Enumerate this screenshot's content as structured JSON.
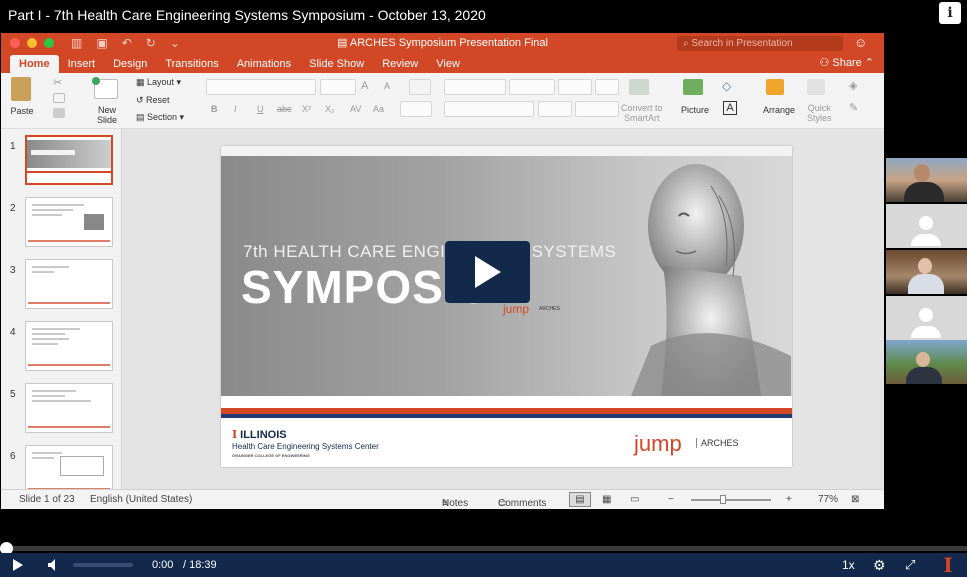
{
  "video": {
    "title": "Part I - 7th Health Care Engineering Systems Symposium - October 13, 2020",
    "info_icon_glyph": "i"
  },
  "ppt": {
    "doc_title": "ARCHES Symposium Presentation Final",
    "search_placeholder": "Search in Presentation",
    "share_label": "Share",
    "tabs": [
      "Home",
      "Insert",
      "Design",
      "Transitions",
      "Animations",
      "Slide Show",
      "Review",
      "View"
    ],
    "ribbon": {
      "paste": "Paste",
      "new_slide_line1": "New",
      "new_slide_line2": "Slide",
      "layout": "Layout",
      "reset": "Reset",
      "section": "Section",
      "convert_line1": "Convert to",
      "convert_line2": "SmartArt",
      "picture": "Picture",
      "arrange": "Arrange",
      "quick_styles_line1": "Quick",
      "quick_styles_line2": "Styles"
    },
    "thumbnails": [
      "1",
      "2",
      "3",
      "4",
      "5",
      "6"
    ],
    "slide": {
      "heading_line1": "7th HEALTH CARE ENGINEERING SYSTEMS",
      "heading_line2": "SYMPOSIUM",
      "jump": "jump",
      "arches": "ARCHES",
      "illinois": "ILLINOIS",
      "illinois_mark": "I",
      "center": "Health Care Engineering Systems Center",
      "college": "GRAINGER COLLEGE OF ENGINEERING"
    },
    "status": {
      "slide_count": "Slide 1 of 23",
      "language": "English (United States)",
      "notes": "Notes",
      "comments": "Comments",
      "zoom": "77%"
    }
  },
  "player": {
    "time_current": "0:00",
    "time_total": "/ 18:39",
    "speed": "1x",
    "progress": 0,
    "brand_mark": "I"
  },
  "colors": {
    "ppt_accent": "#d24726",
    "illinois_blue": "#13294b",
    "illinois_orange": "#d24726"
  }
}
